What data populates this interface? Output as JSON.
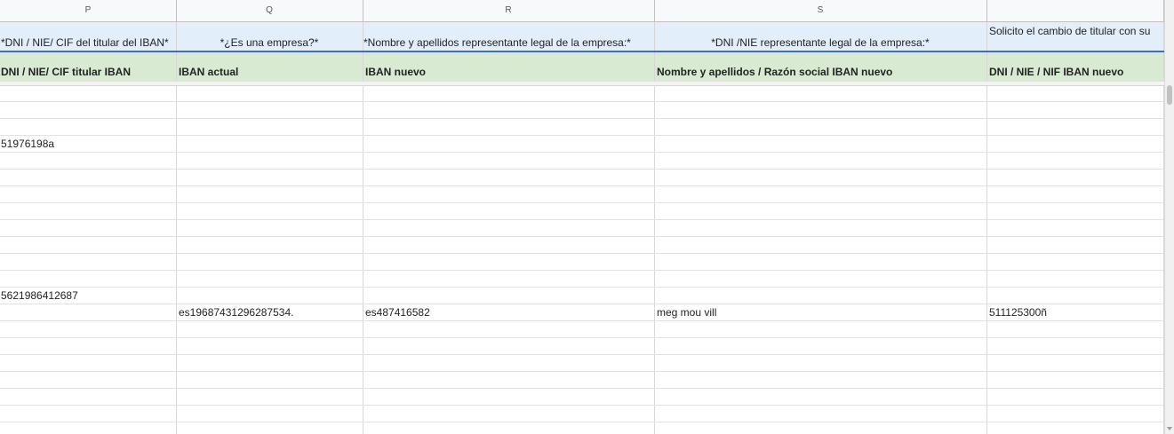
{
  "columns": [
    {
      "letter": "P"
    },
    {
      "letter": "Q",
      "has_filter": true
    },
    {
      "letter": "R"
    },
    {
      "letter": "S"
    },
    {
      "letter": ""
    }
  ],
  "form_header": [
    "*DNI / NIE/ CIF del titular del IBAN*",
    "*¿Es una empresa?*",
    "*Nombre y apellidos representante legal de la empresa:*",
    "*DNI /NIE representante legal de la empresa:*",
    "Solicito el cambio de titular con su"
  ],
  "field_header": [
    "DNI / NIE/ CIF titular IBAN",
    "IBAN actual",
    "IBAN nuevo",
    "Nombre y apellidos / Razón social IBAN nuevo",
    "DNI / NIE / NIF IBAN nuevo"
  ],
  "rows": [
    [
      "",
      "",
      "",
      "",
      ""
    ],
    [
      "",
      "",
      "",
      "",
      ""
    ],
    [
      "",
      "",
      "",
      "",
      ""
    ],
    [
      "51976198a",
      "",
      "",
      "",
      ""
    ],
    [
      "",
      "",
      "",
      "",
      ""
    ],
    [
      "",
      "",
      "",
      "",
      ""
    ],
    [
      "",
      "",
      "",
      "",
      ""
    ],
    [
      "",
      "",
      "",
      "",
      ""
    ],
    [
      "",
      "",
      "",
      "",
      ""
    ],
    [
      "",
      "",
      "",
      "",
      ""
    ],
    [
      "",
      "",
      "",
      "",
      ""
    ],
    [
      "",
      "",
      "",
      "",
      ""
    ],
    [
      "5621986412687",
      "",
      "",
      "",
      ""
    ],
    [
      "",
      "es19687431296287534.",
      "es487416582",
      "meg mou vill",
      "511125300ñ"
    ],
    [
      "",
      "",
      "",
      "",
      ""
    ],
    [
      "",
      "",
      "",
      "",
      ""
    ],
    [
      "",
      "",
      "",
      "",
      ""
    ],
    [
      "",
      "",
      "",
      "",
      ""
    ],
    [
      "",
      "",
      "",
      "",
      ""
    ],
    [
      "",
      "",
      "",
      "",
      ""
    ],
    [
      "",
      "",
      "",
      "",
      ""
    ]
  ],
  "icons": {
    "filter": "filter-dropdown-icon",
    "scroll_down": "scroll-down-arrow-icon"
  }
}
